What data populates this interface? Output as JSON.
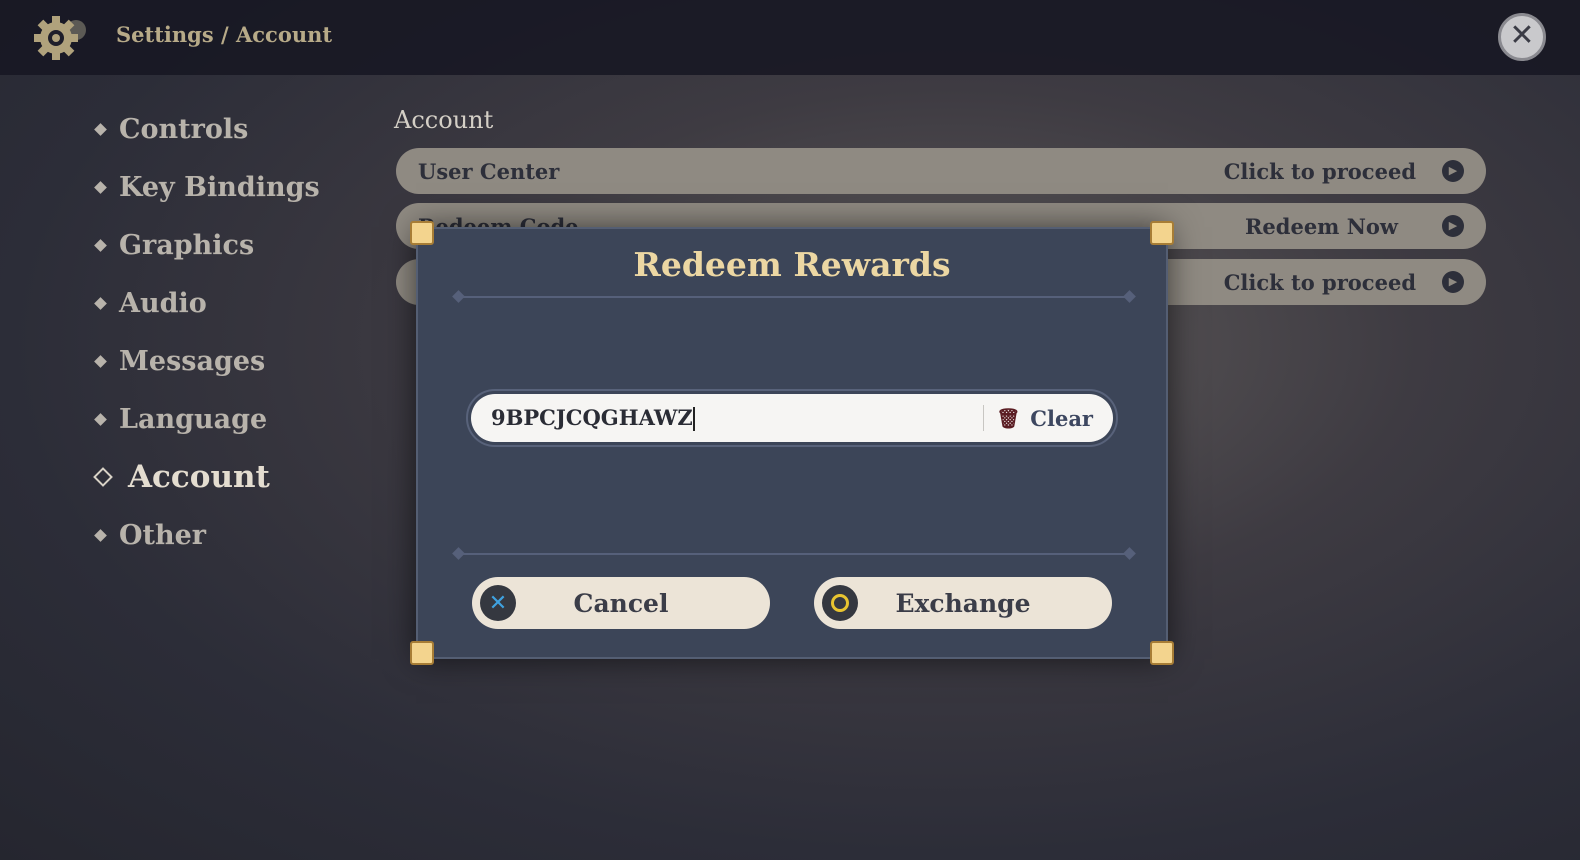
{
  "header": {
    "breadcrumb": "Settings / Account",
    "icon": "gear-icon",
    "close_icon": "close-icon"
  },
  "sidebar": {
    "items": [
      {
        "label": "Controls"
      },
      {
        "label": "Key Bindings"
      },
      {
        "label": "Graphics"
      },
      {
        "label": "Audio"
      },
      {
        "label": "Messages"
      },
      {
        "label": "Language"
      },
      {
        "label": "Account",
        "active": true
      },
      {
        "label": "Other"
      }
    ]
  },
  "main": {
    "section_title": "Account",
    "rows": [
      {
        "label": "User Center",
        "action": "Click to proceed"
      },
      {
        "label": "Redeem Code",
        "action": "Redeem Now"
      },
      {
        "label": "",
        "action": "Click to proceed"
      }
    ]
  },
  "dialog": {
    "title": "Redeem Rewards",
    "code_value": "9BPCJCQGHAWZ",
    "clear_label": "Clear",
    "cancel_label": "Cancel",
    "exchange_label": "Exchange"
  },
  "colors": {
    "accent_gold": "#ecd7a3",
    "cancel_icon": "#3fa2e0",
    "exchange_icon": "#e8c430"
  }
}
